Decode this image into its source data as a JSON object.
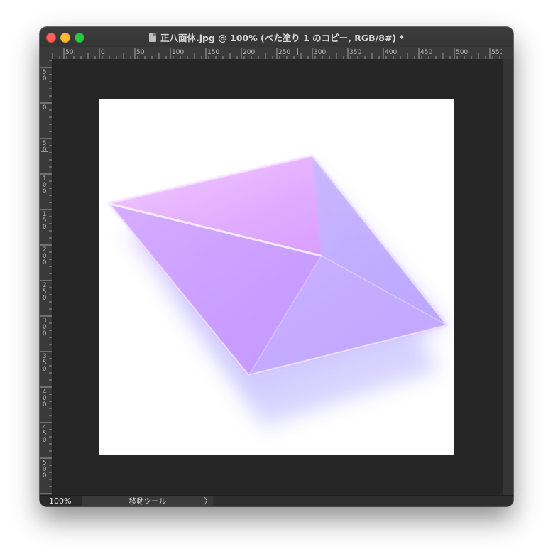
{
  "window": {
    "title": "正八面体.jpg @ 100% (べた塗り 1 のコピー, RGB/8#) *"
  },
  "icons": {
    "close": "close-button",
    "minimize": "minimize-button",
    "maximize": "zoom-button",
    "document": "document-icon",
    "arrow": "chevron-right-icon"
  },
  "ruler": {
    "horizontal_labels": [
      "50",
      "0",
      "50",
      "100",
      "150",
      "200",
      "250",
      "300",
      "350",
      "400",
      "450",
      "500",
      "550"
    ],
    "vertical_labels": [
      "50",
      "0",
      "50",
      "100",
      "150",
      "200",
      "250",
      "300",
      "350",
      "400",
      "450",
      "500",
      "5"
    ]
  },
  "status": {
    "zoom": "100%",
    "tool": "移動ツール",
    "arrow": "〉"
  },
  "colors": {
    "canvas_bg": "#262626",
    "document_bg": "#ffffff",
    "octahedron_light": "#e4a9ff",
    "octahedron_mid": "#c79cff",
    "octahedron_shadow": "#9b8cff"
  }
}
